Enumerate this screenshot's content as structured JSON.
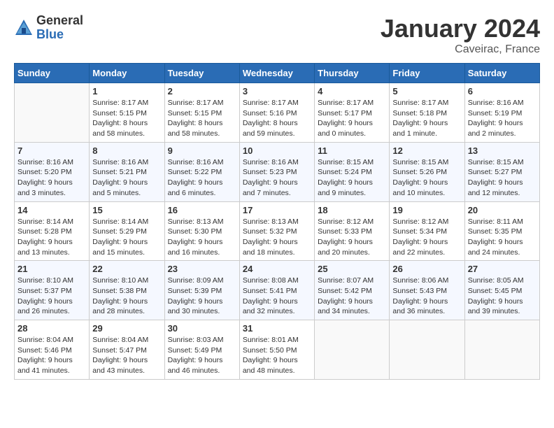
{
  "header": {
    "logo_general": "General",
    "logo_blue": "Blue",
    "month_title": "January 2024",
    "location": "Caveirac, France"
  },
  "weekdays": [
    "Sunday",
    "Monday",
    "Tuesday",
    "Wednesday",
    "Thursday",
    "Friday",
    "Saturday"
  ],
  "weeks": [
    [
      {
        "day": "",
        "info": ""
      },
      {
        "day": "1",
        "info": "Sunrise: 8:17 AM\nSunset: 5:15 PM\nDaylight: 8 hours\nand 58 minutes."
      },
      {
        "day": "2",
        "info": "Sunrise: 8:17 AM\nSunset: 5:15 PM\nDaylight: 8 hours\nand 58 minutes."
      },
      {
        "day": "3",
        "info": "Sunrise: 8:17 AM\nSunset: 5:16 PM\nDaylight: 8 hours\nand 59 minutes."
      },
      {
        "day": "4",
        "info": "Sunrise: 8:17 AM\nSunset: 5:17 PM\nDaylight: 9 hours\nand 0 minutes."
      },
      {
        "day": "5",
        "info": "Sunrise: 8:17 AM\nSunset: 5:18 PM\nDaylight: 9 hours\nand 1 minute."
      },
      {
        "day": "6",
        "info": "Sunrise: 8:16 AM\nSunset: 5:19 PM\nDaylight: 9 hours\nand 2 minutes."
      }
    ],
    [
      {
        "day": "7",
        "info": "Sunrise: 8:16 AM\nSunset: 5:20 PM\nDaylight: 9 hours\nand 3 minutes."
      },
      {
        "day": "8",
        "info": "Sunrise: 8:16 AM\nSunset: 5:21 PM\nDaylight: 9 hours\nand 5 minutes."
      },
      {
        "day": "9",
        "info": "Sunrise: 8:16 AM\nSunset: 5:22 PM\nDaylight: 9 hours\nand 6 minutes."
      },
      {
        "day": "10",
        "info": "Sunrise: 8:16 AM\nSunset: 5:23 PM\nDaylight: 9 hours\nand 7 minutes."
      },
      {
        "day": "11",
        "info": "Sunrise: 8:15 AM\nSunset: 5:24 PM\nDaylight: 9 hours\nand 9 minutes."
      },
      {
        "day": "12",
        "info": "Sunrise: 8:15 AM\nSunset: 5:26 PM\nDaylight: 9 hours\nand 10 minutes."
      },
      {
        "day": "13",
        "info": "Sunrise: 8:15 AM\nSunset: 5:27 PM\nDaylight: 9 hours\nand 12 minutes."
      }
    ],
    [
      {
        "day": "14",
        "info": "Sunrise: 8:14 AM\nSunset: 5:28 PM\nDaylight: 9 hours\nand 13 minutes."
      },
      {
        "day": "15",
        "info": "Sunrise: 8:14 AM\nSunset: 5:29 PM\nDaylight: 9 hours\nand 15 minutes."
      },
      {
        "day": "16",
        "info": "Sunrise: 8:13 AM\nSunset: 5:30 PM\nDaylight: 9 hours\nand 16 minutes."
      },
      {
        "day": "17",
        "info": "Sunrise: 8:13 AM\nSunset: 5:32 PM\nDaylight: 9 hours\nand 18 minutes."
      },
      {
        "day": "18",
        "info": "Sunrise: 8:12 AM\nSunset: 5:33 PM\nDaylight: 9 hours\nand 20 minutes."
      },
      {
        "day": "19",
        "info": "Sunrise: 8:12 AM\nSunset: 5:34 PM\nDaylight: 9 hours\nand 22 minutes."
      },
      {
        "day": "20",
        "info": "Sunrise: 8:11 AM\nSunset: 5:35 PM\nDaylight: 9 hours\nand 24 minutes."
      }
    ],
    [
      {
        "day": "21",
        "info": "Sunrise: 8:10 AM\nSunset: 5:37 PM\nDaylight: 9 hours\nand 26 minutes."
      },
      {
        "day": "22",
        "info": "Sunrise: 8:10 AM\nSunset: 5:38 PM\nDaylight: 9 hours\nand 28 minutes."
      },
      {
        "day": "23",
        "info": "Sunrise: 8:09 AM\nSunset: 5:39 PM\nDaylight: 9 hours\nand 30 minutes."
      },
      {
        "day": "24",
        "info": "Sunrise: 8:08 AM\nSunset: 5:41 PM\nDaylight: 9 hours\nand 32 minutes."
      },
      {
        "day": "25",
        "info": "Sunrise: 8:07 AM\nSunset: 5:42 PM\nDaylight: 9 hours\nand 34 minutes."
      },
      {
        "day": "26",
        "info": "Sunrise: 8:06 AM\nSunset: 5:43 PM\nDaylight: 9 hours\nand 36 minutes."
      },
      {
        "day": "27",
        "info": "Sunrise: 8:05 AM\nSunset: 5:45 PM\nDaylight: 9 hours\nand 39 minutes."
      }
    ],
    [
      {
        "day": "28",
        "info": "Sunrise: 8:04 AM\nSunset: 5:46 PM\nDaylight: 9 hours\nand 41 minutes."
      },
      {
        "day": "29",
        "info": "Sunrise: 8:04 AM\nSunset: 5:47 PM\nDaylight: 9 hours\nand 43 minutes."
      },
      {
        "day": "30",
        "info": "Sunrise: 8:03 AM\nSunset: 5:49 PM\nDaylight: 9 hours\nand 46 minutes."
      },
      {
        "day": "31",
        "info": "Sunrise: 8:01 AM\nSunset: 5:50 PM\nDaylight: 9 hours\nand 48 minutes."
      },
      {
        "day": "",
        "info": ""
      },
      {
        "day": "",
        "info": ""
      },
      {
        "day": "",
        "info": ""
      }
    ]
  ]
}
